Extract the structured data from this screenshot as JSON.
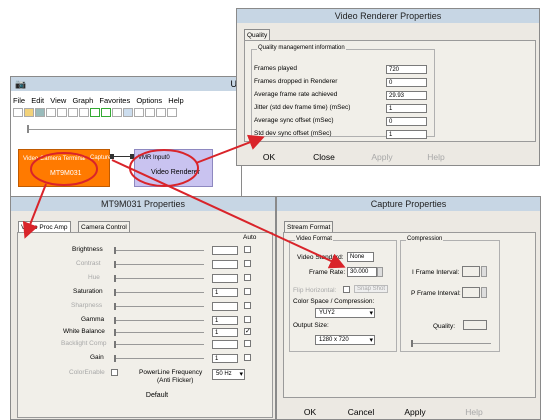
{
  "graphedit": {
    "title_short": "U",
    "menu": [
      "File",
      "Edit",
      "View",
      "Graph",
      "Favorites",
      "Options",
      "Help"
    ],
    "filter1": {
      "label": "Video Camera Terminal",
      "pin": "Capture",
      "name": "MT9M031"
    },
    "filter2": {
      "pin": "VMR Input0",
      "name": "Video Renderer"
    }
  },
  "vr_props": {
    "title": "Video Renderer Properties",
    "tab": "Quality",
    "group": "Quality management information",
    "rows": [
      {
        "label": "Frames played",
        "value": "720"
      },
      {
        "label": "Frames dropped in Renderer",
        "value": "0"
      },
      {
        "label": "Average frame rate achieved",
        "value": "29.93"
      },
      {
        "label": "Jitter (std dev frame time) (mSec)",
        "value": "1"
      },
      {
        "label": "Average sync offset (mSec)",
        "value": "0"
      },
      {
        "label": "Std dev sync offset (mSec)",
        "value": "1"
      }
    ],
    "buttons": {
      "ok": "OK",
      "close": "Close",
      "apply": "Apply",
      "help": "Help"
    }
  },
  "mt_props": {
    "title": "MT9M031 Properties",
    "tabs": [
      "Video Proc Amp",
      "Camera Control"
    ],
    "auto_label": "Auto",
    "rows": [
      {
        "label": "Brightness",
        "value": "",
        "disabled": false,
        "checked": false
      },
      {
        "label": "Contrast",
        "value": "",
        "disabled": true,
        "checked": false
      },
      {
        "label": "Hue",
        "value": "",
        "disabled": true,
        "checked": false
      },
      {
        "label": "Saturation",
        "value": "1",
        "disabled": false,
        "checked": false
      },
      {
        "label": "Sharpness",
        "value": "",
        "disabled": true,
        "checked": false
      },
      {
        "label": "Gamma",
        "value": "1",
        "disabled": false,
        "checked": false
      },
      {
        "label": "White Balance",
        "value": "1",
        "disabled": false,
        "checked": true
      },
      {
        "label": "Backlight Comp",
        "value": "",
        "disabled": true,
        "checked": false
      },
      {
        "label": "Gain",
        "value": "1",
        "disabled": false,
        "checked": false
      }
    ],
    "color_enable": "ColorEnable",
    "powerline_label1": "PowerLine Frequency",
    "powerline_label2": "(Anti Flicker)",
    "powerline_value": "50 Hz",
    "default_button": "Default"
  },
  "cap_props": {
    "title": "Capture Properties",
    "tab": "Stream Format",
    "video_format": "Video Format",
    "video_standard_label": "Video Standard:",
    "video_standard_value": "None",
    "frame_rate_label": "Frame Rate:",
    "frame_rate_value": "30.000",
    "flip_label": "Flip Horizontal:",
    "snap_shot": "Snap Shot",
    "color_space_label": "Color Space / Compression:",
    "color_space_value": "YUY2",
    "output_size_label": "Output Size:",
    "output_size_value": "1280 x 720",
    "compression": "Compression",
    "iframe_label": "I Frame Interval:",
    "pframe_label": "P Frame Interval:",
    "quality_label": "Quality:",
    "buttons": {
      "ok": "OK",
      "cancel": "Cancel",
      "apply": "Apply",
      "help": "Help"
    }
  },
  "colors": {
    "filter_orange": "#ff7a00",
    "filter_lavender": "#c9c3f0",
    "arrow_red": "#d9242a",
    "title_blue": "#c7d6e4"
  }
}
